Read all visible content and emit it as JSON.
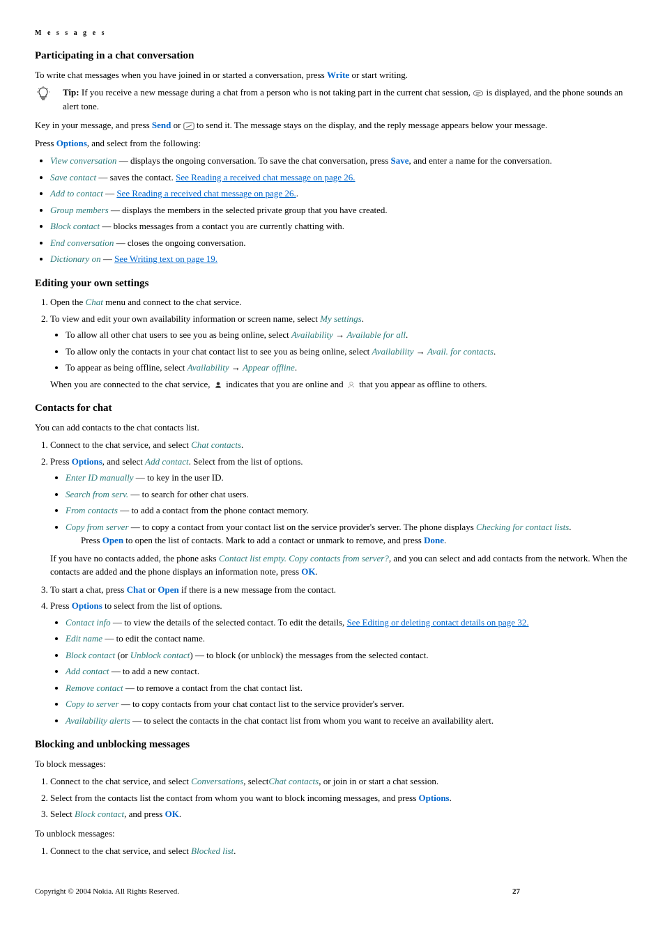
{
  "header": "M e s s a g e s",
  "s1": {
    "title": "Participating in a chat conversation",
    "intro_pre": "To write chat messages when you have joined in or started a conversation, press ",
    "intro_write": "Write",
    "intro_post": " or start writing.",
    "tip_label": "Tip:",
    "tip_text": " If you receive a new message during a chat from a person who is not taking part in the current chat session, ",
    "tip_text2": " is displayed, and the phone sounds an alert tone.",
    "key_pre": "Key in your message, and press ",
    "key_send": "Send",
    "key_mid": " or ",
    "key_post": " to send it. The message stays on the display, and the reply message appears below your message.",
    "press_pre": "Press ",
    "press_options": "Options",
    "press_post": ", and select from the following:",
    "items": [
      {
        "name": "View conversation",
        "text": " — displays the ongoing conversation. To save the chat conversation, press ",
        "save": "Save",
        "text2": ", and enter a name for the conversation."
      },
      {
        "name": "Save contact",
        "text": " — saves the contact. ",
        "link": "See Reading a received chat message on page 26."
      },
      {
        "name": "Add to contact",
        "text": " — ",
        "link": "See Reading a received chat message on page 26.",
        "tail": "."
      },
      {
        "name": "Group members",
        "text": " —  displays the members in the selected private group that you have created."
      },
      {
        "name": "Block contact",
        "text": " — blocks messages from a contact you are currently chatting with."
      },
      {
        "name": "End conversation",
        "text": " —  closes the ongoing conversation."
      },
      {
        "name": "Dictionary on",
        "text": " — ",
        "link": "See Writing text on page 19."
      }
    ]
  },
  "s2": {
    "title": "Editing your own settings",
    "step1_pre": "Open the ",
    "step1_chat": "Chat",
    "step1_post": " menu and connect to the chat service.",
    "step2_pre": "To view and edit your own availability information or screen name, select ",
    "step2_my": "My settings",
    "step2_post": ".",
    "sub1_pre": "To allow all other chat users to see you as being online, select ",
    "sub1_a": "Availability",
    "sub1_b": "Available for all",
    "sub1_post": ".",
    "sub2_pre": "To allow only the contacts in your chat contact list to see you as being online, select ",
    "sub2_a": "Availability",
    "sub2_b": "Avail. for contacts",
    "sub2_post": ".",
    "sub3_pre": "To appear as being offline, select ",
    "sub3_a": "Availability",
    "sub3_b": "Appear offline",
    "sub3_post": ".",
    "note_pre": "When you are connected to the chat service, ",
    "note_mid": " indicates that you are online and ",
    "note_post": " that you appear as offline to others."
  },
  "s3": {
    "title": "Contacts for chat",
    "intro": "You can add contacts to the chat contacts list.",
    "step1_pre": "Connect to the chat service, and select ",
    "step1_cc": "Chat contacts",
    "step1_post": ".",
    "step2_pre": "Press ",
    "step2_opt": "Options",
    "step2_mid": ", and select ",
    "step2_add": "Add contact",
    "step2_post": ". Select from the list of options.",
    "sub": [
      {
        "name": "Enter ID manually",
        "text": " — to key in the user ID."
      },
      {
        "name": "Search from serv.",
        "text": " — to search for other chat users."
      },
      {
        "name": "From contacts",
        "text": " — to add a contact from the phone contact memory."
      },
      {
        "name": "Copy from server",
        "text": " — to copy a contact from your contact list on the service provider's server. The phone displays ",
        "name2": "Checking for contact lists",
        "tail": "."
      }
    ],
    "open_pre": "Press ",
    "open_open": "Open",
    "open_mid": " to open the list of contacts. Mark to add a contact or unmark to remove, and press ",
    "open_done": "Done",
    "open_post": ".",
    "nocontacts_pre": "If you have no contacts added, the phone asks ",
    "nocontacts_q": "Contact list empty. Copy contacts from server?",
    "nocontacts_mid": ", and you can select and add contacts from the network. When the contacts are added and the phone displays an information note, press ",
    "nocontacts_ok": "OK",
    "nocontacts_post": ".",
    "step3_pre": "To start a chat, press ",
    "step3_chat": "Chat",
    "step3_or": " or ",
    "step3_open": "Open",
    "step3_post": " if there is a new message from the contact.",
    "step4_pre": "Press ",
    "step4_opt": "Options",
    "step4_post": " to select from the list of options.",
    "sub4": [
      {
        "name": "Contact info",
        "text": " — to view the details of the selected contact. To edit the details, ",
        "link": "See Editing or deleting contact details on page 32."
      },
      {
        "name": "Edit name",
        "text": " — to edit the contact name."
      },
      {
        "name": "Block contact",
        "paren_pre": " (or ",
        "name2": "Unblock contact",
        "paren_post": ") — to block (or unblock) the messages from the selected contact."
      },
      {
        "name": "Add contact",
        "text": " — to add a new contact."
      },
      {
        "name": "Remove contact",
        "text": " — to remove a contact from the chat contact list."
      },
      {
        "name": "Copy to server",
        "text": " — to copy contacts from your chat contact list to the service provider's server."
      },
      {
        "name": "Availability alerts",
        "text": " — to select the contacts in the chat contact list from whom you want to receive an availability alert."
      }
    ]
  },
  "s4": {
    "title": "Blocking and unblocking messages",
    "block_intro": "To block messages:",
    "b1_pre": "Connect to the chat service, and select ",
    "b1_conv": "Conversations",
    "b1_mid": ", select",
    "b1_cc": "Chat contacts",
    "b1_post": ", or join in or start a chat session.",
    "b2_pre": "Select from the contacts list the contact from whom you want to block incoming messages, and press ",
    "b2_opt": "Options",
    "b2_post": ".",
    "b3_pre": "Select ",
    "b3_bc": "Block contact",
    "b3_mid": ", and press ",
    "b3_ok": "OK",
    "b3_post": ".",
    "unblock_intro": "To unblock messages:",
    "u1_pre": "Connect to the chat service, and select ",
    "u1_bl": "Blocked list",
    "u1_post": "."
  },
  "footer": {
    "copyright": "Copyright © 2004 Nokia. All Rights Reserved.",
    "page": "27"
  }
}
